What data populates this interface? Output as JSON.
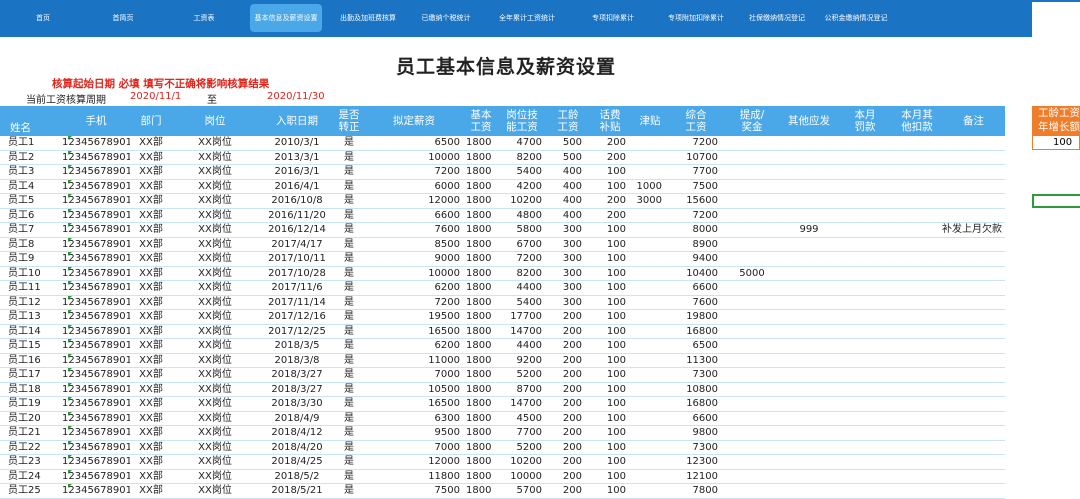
{
  "nav": [
    {
      "label": "首页",
      "active": false
    },
    {
      "label": "首简页",
      "active": false
    },
    {
      "label": "工资表",
      "active": false
    },
    {
      "label": "基本信息及薪资设置",
      "active": true
    },
    {
      "label": "出勤及加班费核算",
      "active": false
    },
    {
      "label": "已缴纳个税统计",
      "active": false
    },
    {
      "label": "全年累计工资统计",
      "active": false
    },
    {
      "label": "专项扣除累计",
      "active": false
    },
    {
      "label": "专项附加扣除累计",
      "active": false
    },
    {
      "label": "社保缴纳情况登记",
      "active": false
    },
    {
      "label": "公积金缴纳情况登记",
      "active": false
    }
  ],
  "page_title": "员工基本信息及薪资设置",
  "warning": "核算起始日期 必填 填写不正确将影响核算结果",
  "period": {
    "label": "当前工资核算周期",
    "start": "2020/11/1",
    "to": "至",
    "end": "2020/11/30"
  },
  "columns": [
    "姓名",
    "手机",
    "部门",
    "岗位",
    "入职日期",
    "是否转正",
    "拟定薪资",
    "基本工资",
    "岗位技能工资",
    "工龄工资",
    "话费补贴",
    "津贴",
    "综合工资",
    "提成/奖金",
    "其他应发",
    "本月罚款",
    "本月其他扣款",
    "备注"
  ],
  "side": {
    "header_line1": "工龄工资",
    "header_line2": "年增长额",
    "value": "100"
  },
  "rows": [
    {
      "name": "员工1",
      "phone": "12345678901",
      "dept": "XX部",
      "pos": "XX岗位",
      "date": "2010/3/1",
      "reg": "是",
      "sal": "6500",
      "base": "1800",
      "skill": "4700",
      "seniority": "500",
      "phone_sub": "200",
      "allow": "",
      "total": "7200",
      "bonus": "",
      "other": "",
      "fine": "",
      "deduct": "",
      "note": ""
    },
    {
      "name": "员工2",
      "phone": "12345678901",
      "dept": "XX部",
      "pos": "XX岗位",
      "date": "2013/3/1",
      "reg": "是",
      "sal": "10000",
      "base": "1800",
      "skill": "8200",
      "seniority": "500",
      "phone_sub": "200",
      "allow": "",
      "total": "10700",
      "bonus": "",
      "other": "",
      "fine": "",
      "deduct": "",
      "note": ""
    },
    {
      "name": "员工3",
      "phone": "12345678901",
      "dept": "XX部",
      "pos": "XX岗位",
      "date": "2016/3/1",
      "reg": "是",
      "sal": "7200",
      "base": "1800",
      "skill": "5400",
      "seniority": "400",
      "phone_sub": "100",
      "allow": "",
      "total": "7700",
      "bonus": "",
      "other": "",
      "fine": "",
      "deduct": "",
      "note": ""
    },
    {
      "name": "员工4",
      "phone": "12345678901",
      "dept": "XX部",
      "pos": "XX岗位",
      "date": "2016/4/1",
      "reg": "是",
      "sal": "6000",
      "base": "1800",
      "skill": "4200",
      "seniority": "400",
      "phone_sub": "100",
      "allow": "1000",
      "total": "7500",
      "bonus": "",
      "other": "",
      "fine": "",
      "deduct": "",
      "note": ""
    },
    {
      "name": "员工5",
      "phone": "12345678901",
      "dept": "XX部",
      "pos": "XX岗位",
      "date": "2016/10/8",
      "reg": "是",
      "sal": "12000",
      "base": "1800",
      "skill": "10200",
      "seniority": "400",
      "phone_sub": "200",
      "allow": "3000",
      "total": "15600",
      "bonus": "",
      "other": "",
      "fine": "",
      "deduct": "",
      "note": ""
    },
    {
      "name": "员工6",
      "phone": "12345678901",
      "dept": "XX部",
      "pos": "XX岗位",
      "date": "2016/11/20",
      "reg": "是",
      "sal": "6600",
      "base": "1800",
      "skill": "4800",
      "seniority": "400",
      "phone_sub": "200",
      "allow": "",
      "total": "7200",
      "bonus": "",
      "other": "",
      "fine": "",
      "deduct": "",
      "note": ""
    },
    {
      "name": "员工7",
      "phone": "12345678901",
      "dept": "XX部",
      "pos": "XX岗位",
      "date": "2016/12/14",
      "reg": "是",
      "sal": "7600",
      "base": "1800",
      "skill": "5800",
      "seniority": "300",
      "phone_sub": "100",
      "allow": "",
      "total": "8000",
      "bonus": "",
      "other": "999",
      "fine": "",
      "deduct": "",
      "note": "补发上月欠款"
    },
    {
      "name": "员工8",
      "phone": "12345678901",
      "dept": "XX部",
      "pos": "XX岗位",
      "date": "2017/4/17",
      "reg": "是",
      "sal": "8500",
      "base": "1800",
      "skill": "6700",
      "seniority": "300",
      "phone_sub": "100",
      "allow": "",
      "total": "8900",
      "bonus": "",
      "other": "",
      "fine": "",
      "deduct": "",
      "note": ""
    },
    {
      "name": "员工9",
      "phone": "12345678901",
      "dept": "XX部",
      "pos": "XX岗位",
      "date": "2017/10/11",
      "reg": "是",
      "sal": "9000",
      "base": "1800",
      "skill": "7200",
      "seniority": "300",
      "phone_sub": "100",
      "allow": "",
      "total": "9400",
      "bonus": "",
      "other": "",
      "fine": "",
      "deduct": "",
      "note": ""
    },
    {
      "name": "员工10",
      "phone": "12345678901",
      "dept": "XX部",
      "pos": "XX岗位",
      "date": "2017/10/28",
      "reg": "是",
      "sal": "10000",
      "base": "1800",
      "skill": "8200",
      "seniority": "300",
      "phone_sub": "100",
      "allow": "",
      "total": "10400",
      "bonus": "5000",
      "other": "",
      "fine": "",
      "deduct": "",
      "note": ""
    },
    {
      "name": "员工11",
      "phone": "12345678901",
      "dept": "XX部",
      "pos": "XX岗位",
      "date": "2017/11/6",
      "reg": "是",
      "sal": "6200",
      "base": "1800",
      "skill": "4400",
      "seniority": "300",
      "phone_sub": "100",
      "allow": "",
      "total": "6600",
      "bonus": "",
      "other": "",
      "fine": "",
      "deduct": "",
      "note": ""
    },
    {
      "name": "员工12",
      "phone": "12345678901",
      "dept": "XX部",
      "pos": "XX岗位",
      "date": "2017/11/14",
      "reg": "是",
      "sal": "7200",
      "base": "1800",
      "skill": "5400",
      "seniority": "300",
      "phone_sub": "100",
      "allow": "",
      "total": "7600",
      "bonus": "",
      "other": "",
      "fine": "",
      "deduct": "",
      "note": ""
    },
    {
      "name": "员工13",
      "phone": "12345678901",
      "dept": "XX部",
      "pos": "XX岗位",
      "date": "2017/12/16",
      "reg": "是",
      "sal": "19500",
      "base": "1800",
      "skill": "17700",
      "seniority": "200",
      "phone_sub": "100",
      "allow": "",
      "total": "19800",
      "bonus": "",
      "other": "",
      "fine": "",
      "deduct": "",
      "note": ""
    },
    {
      "name": "员工14",
      "phone": "12345678901",
      "dept": "XX部",
      "pos": "XX岗位",
      "date": "2017/12/25",
      "reg": "是",
      "sal": "16500",
      "base": "1800",
      "skill": "14700",
      "seniority": "200",
      "phone_sub": "100",
      "allow": "",
      "total": "16800",
      "bonus": "",
      "other": "",
      "fine": "",
      "deduct": "",
      "note": ""
    },
    {
      "name": "员工15",
      "phone": "12345678901",
      "dept": "XX部",
      "pos": "XX岗位",
      "date": "2018/3/5",
      "reg": "是",
      "sal": "6200",
      "base": "1800",
      "skill": "4400",
      "seniority": "200",
      "phone_sub": "100",
      "allow": "",
      "total": "6500",
      "bonus": "",
      "other": "",
      "fine": "",
      "deduct": "",
      "note": ""
    },
    {
      "name": "员工16",
      "phone": "12345678901",
      "dept": "XX部",
      "pos": "XX岗位",
      "date": "2018/3/8",
      "reg": "是",
      "sal": "11000",
      "base": "1800",
      "skill": "9200",
      "seniority": "200",
      "phone_sub": "100",
      "allow": "",
      "total": "11300",
      "bonus": "",
      "other": "",
      "fine": "",
      "deduct": "",
      "note": ""
    },
    {
      "name": "员工17",
      "phone": "12345678901",
      "dept": "XX部",
      "pos": "XX岗位",
      "date": "2018/3/27",
      "reg": "是",
      "sal": "7000",
      "base": "1800",
      "skill": "5200",
      "seniority": "200",
      "phone_sub": "100",
      "allow": "",
      "total": "7300",
      "bonus": "",
      "other": "",
      "fine": "",
      "deduct": "",
      "note": ""
    },
    {
      "name": "员工18",
      "phone": "12345678901",
      "dept": "XX部",
      "pos": "XX岗位",
      "date": "2018/3/27",
      "reg": "是",
      "sal": "10500",
      "base": "1800",
      "skill": "8700",
      "seniority": "200",
      "phone_sub": "100",
      "allow": "",
      "total": "10800",
      "bonus": "",
      "other": "",
      "fine": "",
      "deduct": "",
      "note": ""
    },
    {
      "name": "员工19",
      "phone": "12345678901",
      "dept": "XX部",
      "pos": "XX岗位",
      "date": "2018/3/30",
      "reg": "是",
      "sal": "16500",
      "base": "1800",
      "skill": "14700",
      "seniority": "200",
      "phone_sub": "100",
      "allow": "",
      "total": "16800",
      "bonus": "",
      "other": "",
      "fine": "",
      "deduct": "",
      "note": ""
    },
    {
      "name": "员工20",
      "phone": "12345678901",
      "dept": "XX部",
      "pos": "XX岗位",
      "date": "2018/4/9",
      "reg": "是",
      "sal": "6300",
      "base": "1800",
      "skill": "4500",
      "seniority": "200",
      "phone_sub": "100",
      "allow": "",
      "total": "6600",
      "bonus": "",
      "other": "",
      "fine": "",
      "deduct": "",
      "note": ""
    },
    {
      "name": "员工21",
      "phone": "12345678901",
      "dept": "XX部",
      "pos": "XX岗位",
      "date": "2018/4/12",
      "reg": "是",
      "sal": "9500",
      "base": "1800",
      "skill": "7700",
      "seniority": "200",
      "phone_sub": "100",
      "allow": "",
      "total": "9800",
      "bonus": "",
      "other": "",
      "fine": "",
      "deduct": "",
      "note": ""
    },
    {
      "name": "员工22",
      "phone": "12345678901",
      "dept": "XX部",
      "pos": "XX岗位",
      "date": "2018/4/20",
      "reg": "是",
      "sal": "7000",
      "base": "1800",
      "skill": "5200",
      "seniority": "200",
      "phone_sub": "100",
      "allow": "",
      "total": "7300",
      "bonus": "",
      "other": "",
      "fine": "",
      "deduct": "",
      "note": ""
    },
    {
      "name": "员工23",
      "phone": "12345678901",
      "dept": "XX部",
      "pos": "XX岗位",
      "date": "2018/4/25",
      "reg": "是",
      "sal": "12000",
      "base": "1800",
      "skill": "10200",
      "seniority": "200",
      "phone_sub": "100",
      "allow": "",
      "total": "12300",
      "bonus": "",
      "other": "",
      "fine": "",
      "deduct": "",
      "note": ""
    },
    {
      "name": "员工24",
      "phone": "12345678901",
      "dept": "XX部",
      "pos": "XX岗位",
      "date": "2018/5/2",
      "reg": "是",
      "sal": "11800",
      "base": "1800",
      "skill": "10000",
      "seniority": "200",
      "phone_sub": "100",
      "allow": "",
      "total": "12100",
      "bonus": "",
      "other": "",
      "fine": "",
      "deduct": "",
      "note": ""
    },
    {
      "name": "员工25",
      "phone": "12345678901",
      "dept": "XX部",
      "pos": "XX岗位",
      "date": "2018/5/21",
      "reg": "是",
      "sal": "7500",
      "base": "1800",
      "skill": "5700",
      "seniority": "200",
      "phone_sub": "100",
      "allow": "",
      "total": "7800",
      "bonus": "",
      "other": "",
      "fine": "",
      "deduct": "",
      "note": ""
    }
  ]
}
